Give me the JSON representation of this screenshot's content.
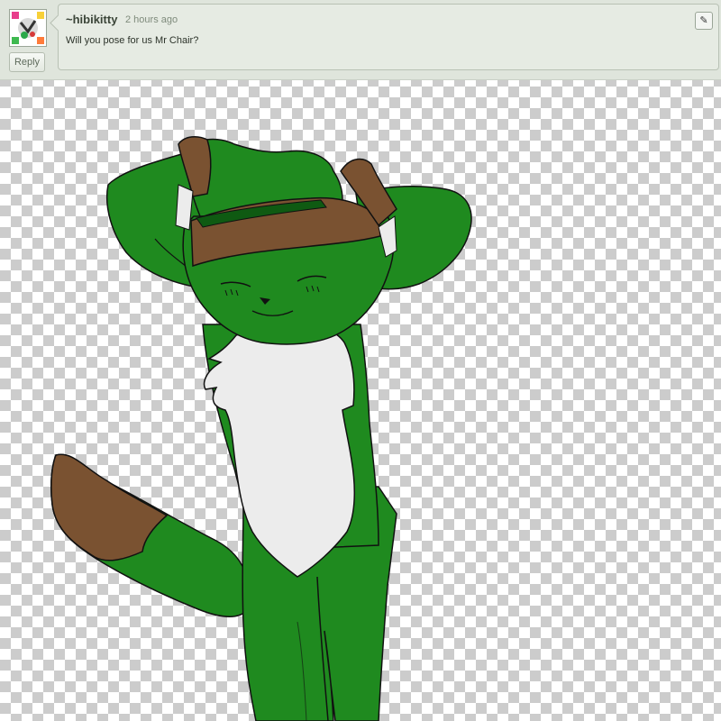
{
  "comment": {
    "username": "~hibikitty",
    "timestamp": "2 hours ago",
    "message": "Will you pose for us Mr Chair?",
    "reply_label": "Reply",
    "edit_icon": "pencil-icon"
  },
  "colors": {
    "fur_green": "#1f8a1f",
    "hat_brown": "#7a5231",
    "bib_white": "#ececec",
    "panel_bg": "#e6ebe3"
  }
}
